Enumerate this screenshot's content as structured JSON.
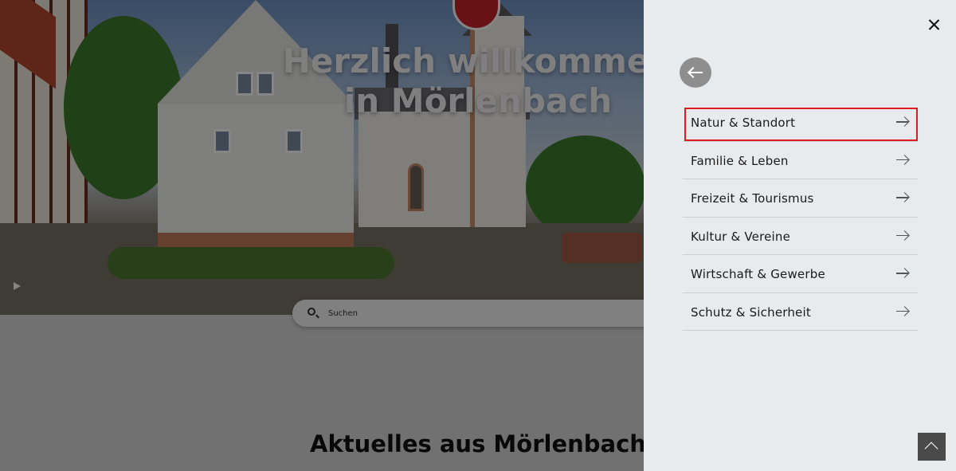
{
  "hero": {
    "title_line1": "Herzlich willkommen",
    "title_line2": "in Mörlenbach"
  },
  "search": {
    "placeholder": "Suchen"
  },
  "news": {
    "heading": "Aktuelles aus Mörlenbach"
  },
  "menu": {
    "items": [
      {
        "label": "Natur & Standort",
        "highlighted": true
      },
      {
        "label": "Familie & Leben"
      },
      {
        "label": "Freizeit & Tourismus"
      },
      {
        "label": "Kultur & Vereine"
      },
      {
        "label": "Wirtschaft & Gewerbe"
      },
      {
        "label": "Schutz & Sicherheit"
      }
    ]
  },
  "icons": {
    "close": "close-icon",
    "back": "back-arrow-icon",
    "item_arrow": "arrow-right-icon",
    "scroll_top": "chevron-up-icon",
    "search": "search-icon",
    "play": "play-icon"
  },
  "colors": {
    "highlight": "#e01b1b",
    "panel_bg": "#e8ebee",
    "back_button": "#8e8e8e"
  }
}
